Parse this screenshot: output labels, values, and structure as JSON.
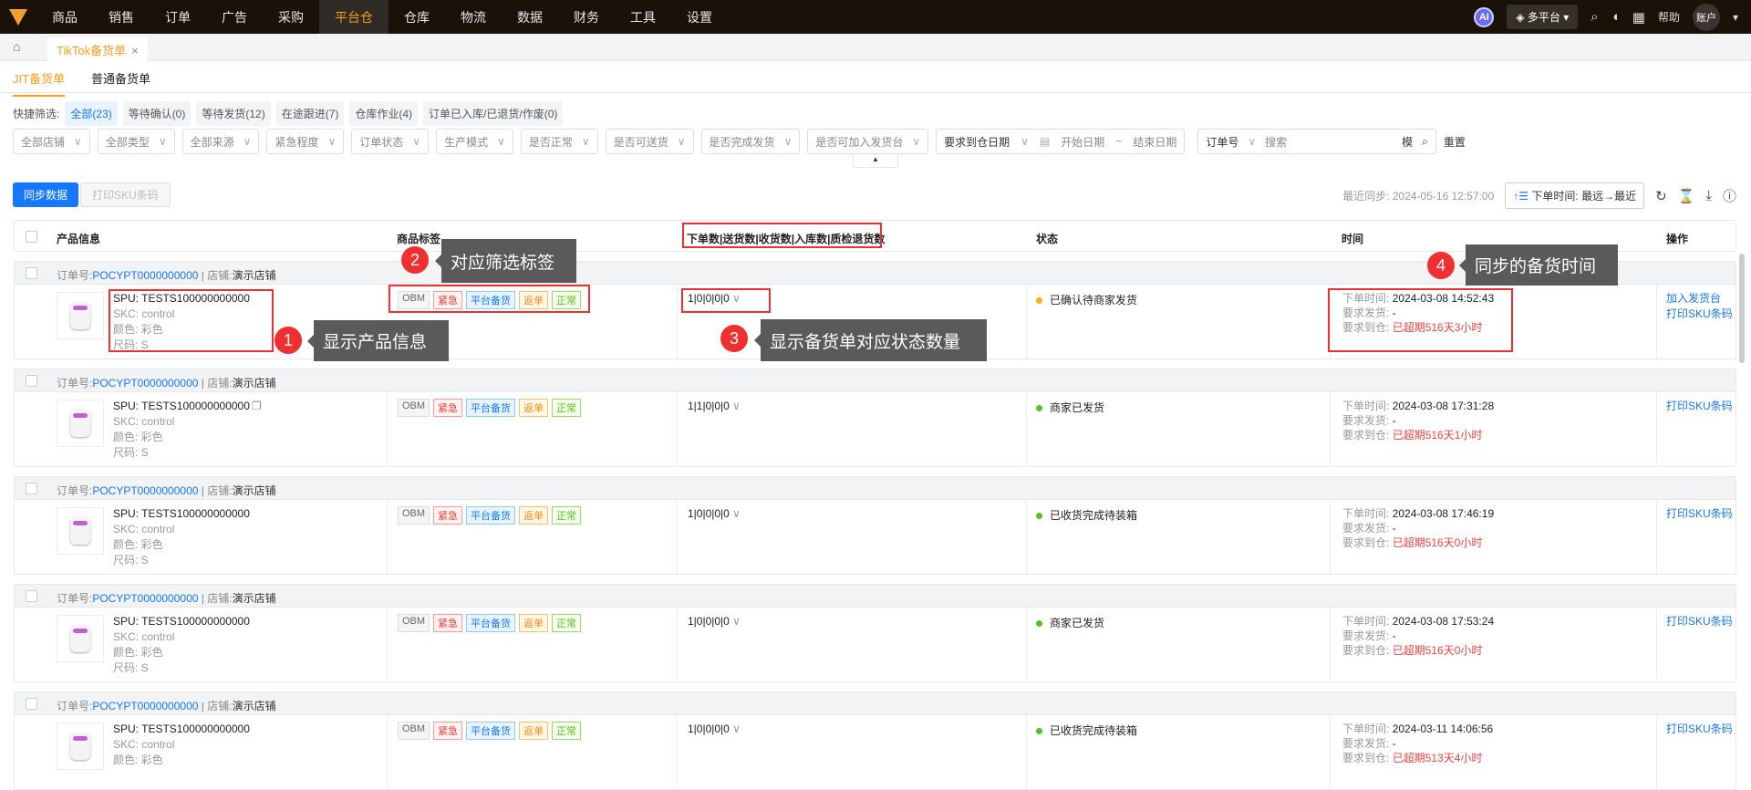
{
  "nav": {
    "items": [
      "商品",
      "销售",
      "订单",
      "广告",
      "采购",
      "平台仓",
      "仓库",
      "物流",
      "数据",
      "财务",
      "工具",
      "设置"
    ],
    "active": "平台仓",
    "ai": "AI",
    "platform": "多平台",
    "help": "帮助",
    "account": "账户"
  },
  "tabs": {
    "open_tab": "TikTok备货单",
    "close": "×"
  },
  "subtabs": [
    "JIT备货单",
    "普通备货单"
  ],
  "quick": {
    "label": "快捷筛选:",
    "items": [
      "全部(23)",
      "等待确认(0)",
      "等待发货(12)",
      "在途跟进(7)",
      "仓库作业(4)",
      "订单已入库/已退货/作废(0)"
    ]
  },
  "filters": {
    "selects": [
      "全部店铺",
      "全部类型",
      "全部来源",
      "紧急程度",
      "订单状态",
      "生产模式",
      "是否正常",
      "是否可送货",
      "是否完成发货",
      "是否可加入发货台"
    ],
    "date_type": "要求到仓日期",
    "start": "开始日期",
    "tilde": "~",
    "end": "结束日期",
    "search_type": "订单号",
    "search_placeholder": "搜索",
    "fuzzy": "模",
    "reset": "重置"
  },
  "toolbar": {
    "sync": "同步数据",
    "print": "打印SKU条码",
    "last_sync": "最近同步: 2024-05-16 12:57:00",
    "sort": "下单时间: 最远→最近"
  },
  "table": {
    "headers": [
      "产品信息",
      "商品标签",
      "下单数|送货数|收货数|入库数|质检退货数",
      "状态",
      "时间",
      "操作"
    ],
    "order_label": "订单号:",
    "order_no": "POCYPT0000000000",
    "shop_label": "店铺:",
    "shop": "演示店铺",
    "tags": [
      "OBM",
      "紧急",
      "平台备货",
      "返单",
      "正常"
    ],
    "time_labels": [
      "下单时间:",
      "要求发货:",
      "要求到仓:"
    ],
    "rows": [
      {
        "spu": "SPU: TESTS100000000000",
        "skc": "SKC: control",
        "color": "颜色: 彩色",
        "size": "尺码: S",
        "counts": "1|0|0|0|0",
        "status": "已确认待商家发货",
        "status_color": "#faad14",
        "order_time": "2024-03-08 14:52:43",
        "ship": "-",
        "arrive": "已超期516天3小时",
        "ops": [
          "加入发货台",
          "打印SKU条码"
        ]
      },
      {
        "spu": "SPU: TESTS100000000000",
        "skc": "SKC: control",
        "color": "颜色: 彩色",
        "size": "尺码: S",
        "counts": "1|1|0|0|0",
        "status": "商家已发货",
        "status_color": "#52c41a",
        "order_time": "2024-03-08 17:31:28",
        "ship": "-",
        "arrive": "已超期516天1小时",
        "ops": [
          "打印SKU条码"
        ]
      },
      {
        "spu": "SPU: TESTS100000000000",
        "skc": "SKC: control",
        "color": "颜色: 彩色",
        "size": "尺码: S",
        "counts": "1|0|0|0|0",
        "status": "已收货完成待装箱",
        "status_color": "#52c41a",
        "order_time": "2024-03-08 17:46:19",
        "ship": "-",
        "arrive": "已超期516天0小时",
        "ops": [
          "打印SKU条码"
        ]
      },
      {
        "spu": "SPU: TESTS100000000000",
        "skc": "SKC: control",
        "color": "颜色: 彩色",
        "size": "尺码: S",
        "counts": "1|0|0|0|0",
        "status": "商家已发货",
        "status_color": "#52c41a",
        "order_time": "2024-03-08 17:53:24",
        "ship": "-",
        "arrive": "已超期516天0小时",
        "ops": [
          "打印SKU条码"
        ]
      },
      {
        "spu": "SPU: TESTS100000000000",
        "skc": "SKC: control",
        "color": "颜色: 彩色",
        "size": "",
        "counts": "1|0|0|0|0",
        "status": "已收货完成待装箱",
        "status_color": "#52c41a",
        "order_time": "2024-03-11 14:06:56",
        "ship": "-",
        "arrive": "已超期513天4小时",
        "ops": [
          "打印SKU条码"
        ]
      }
    ]
  },
  "annotations": [
    {
      "n": "1",
      "text": "显示产品信息"
    },
    {
      "n": "2",
      "text": "对应筛选标签"
    },
    {
      "n": "3",
      "text": "显示备货单对应状态数量"
    },
    {
      "n": "4",
      "text": "同步的备货时间"
    }
  ]
}
